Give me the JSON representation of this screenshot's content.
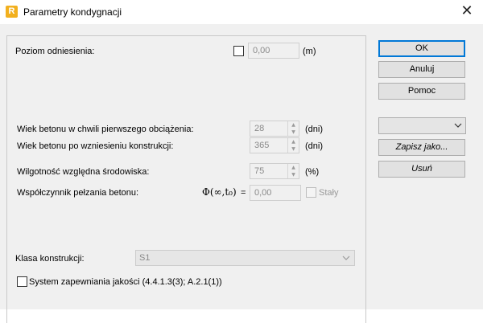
{
  "window": {
    "title": "Parametry kondygnacji",
    "app_icon": "R"
  },
  "reference_level": {
    "label": "Poziom odniesienia:",
    "checked": false,
    "value": "0,00",
    "unit": "(m)"
  },
  "first_load_age": {
    "label": "Wiek betonu w chwili pierwszego obciążenia:",
    "value": "28",
    "unit": "(dni)"
  },
  "construction_age": {
    "label": "Wiek betonu po wzniesieniu konstrukcji:",
    "value": "365",
    "unit": "(dni)"
  },
  "humidity": {
    "label": "Wilgotność względna środowiska:",
    "value": "75",
    "unit": "(%)"
  },
  "creep": {
    "label": "Współczynnik pełzania betonu:",
    "symbol": "Φ(∞,t₀)",
    "equals": "=",
    "value": "0,00",
    "constant_label": "Stały",
    "constant_checked": false
  },
  "structure_class": {
    "label": "Klasa konstrukcji:",
    "value": "S1"
  },
  "quality_system": {
    "label": "System zapewniania jakości (4.4.1.3(3); A.2.1(1))",
    "checked": false
  },
  "buttons": {
    "ok": "OK",
    "cancel": "Anuluj",
    "help": "Pomoc",
    "save_as": "Zapisz jako...",
    "delete": "Usuń"
  },
  "preset_combo": {
    "value": ""
  },
  "colors": {
    "dialog_bg": "#f0f0f0",
    "default_button_border": "#0078d7",
    "app_icon": "#f2b01e"
  }
}
